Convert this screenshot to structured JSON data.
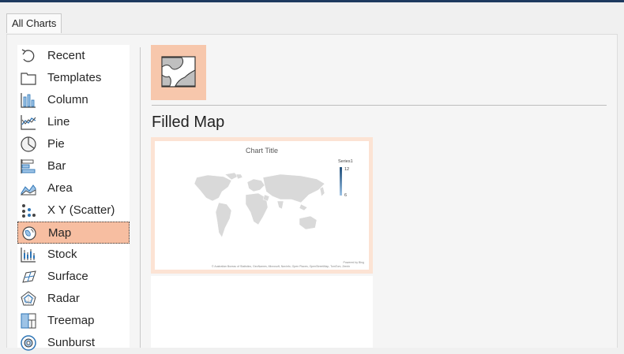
{
  "tabs": {
    "all_charts": "All Charts"
  },
  "sidebar": {
    "items": [
      {
        "label": "Recent",
        "icon": "recent-icon"
      },
      {
        "label": "Templates",
        "icon": "templates-icon"
      },
      {
        "label": "Column",
        "icon": "column-chart-icon"
      },
      {
        "label": "Line",
        "icon": "line-chart-icon"
      },
      {
        "label": "Pie",
        "icon": "pie-chart-icon"
      },
      {
        "label": "Bar",
        "icon": "bar-chart-icon"
      },
      {
        "label": "Area",
        "icon": "area-chart-icon"
      },
      {
        "label": "X Y (Scatter)",
        "icon": "scatter-chart-icon"
      },
      {
        "label": "Map",
        "icon": "map-chart-icon",
        "selected": true
      },
      {
        "label": "Stock",
        "icon": "stock-chart-icon"
      },
      {
        "label": "Surface",
        "icon": "surface-chart-icon"
      },
      {
        "label": "Radar",
        "icon": "radar-chart-icon"
      },
      {
        "label": "Treemap",
        "icon": "treemap-chart-icon"
      },
      {
        "label": "Sunburst",
        "icon": "sunburst-chart-icon"
      }
    ]
  },
  "main": {
    "subtype_icon": "filled-map-icon",
    "section_title": "Filled Map",
    "preview": {
      "chart_title": "Chart Title",
      "legend_title": "Series1",
      "legend_max": "12",
      "legend_min": "6",
      "powered_by": "Powered by Bing",
      "attribution": "© Australian Bureau of Statistics, GeoNames, Microsoft, Navinfo, Open Places, OpenStreetMap, TomTom, Zenrin"
    }
  },
  "colors": {
    "selected_bg": "#f7bea1",
    "accent": "#f7c7ac",
    "icon_blue": "#2e75b6",
    "map_gray": "#d9d9d9"
  }
}
